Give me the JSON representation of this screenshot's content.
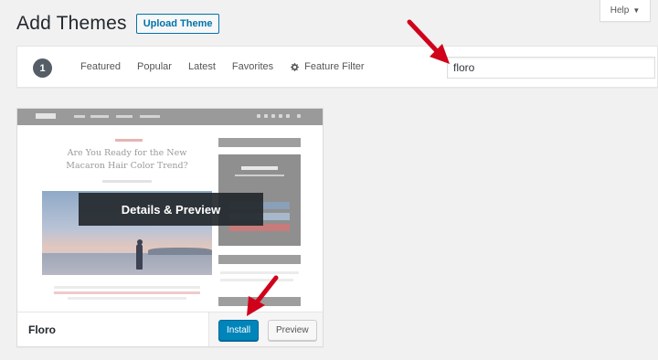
{
  "help": {
    "label": "Help"
  },
  "header": {
    "title": "Add Themes",
    "upload_label": "Upload Theme"
  },
  "filter": {
    "count": "1",
    "links": [
      "Featured",
      "Popular",
      "Latest",
      "Favorites"
    ],
    "feature_filter_label": "Feature Filter",
    "search_value": "floro"
  },
  "theme": {
    "name": "Floro",
    "overlay_label": "Details & Preview",
    "install_label": "Install",
    "preview_label": "Preview",
    "screenshot_headline": "Are You Ready for the New Macaron Hair Color Trend?"
  },
  "colors": {
    "primary_button": "#0085ba",
    "arrow": "#d0021b",
    "link": "#0073aa"
  },
  "icons": {
    "gear": "gear-icon",
    "caret": "caret-down-icon",
    "arrow": "red-arrow-icon"
  }
}
